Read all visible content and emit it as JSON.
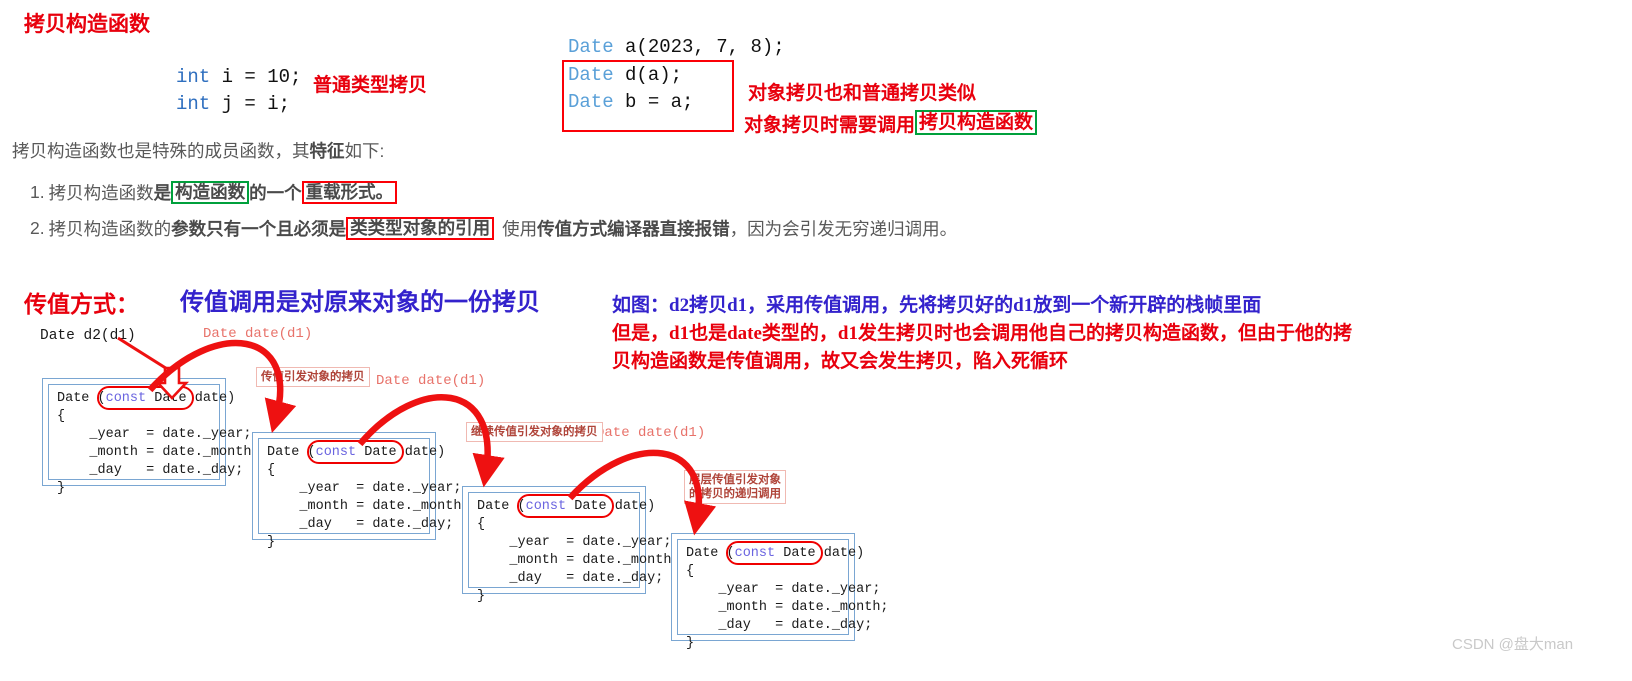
{
  "colors": {
    "red": "#e8000d",
    "blue": "#3322cc",
    "green": "#00a03c",
    "code_blue": "#2f6fbf",
    "frame_blue": "#7aa6d2",
    "prose_gray": "#595959",
    "watermark_gray": "#c9c9c9"
  },
  "header": {
    "title": "拷贝构造函数"
  },
  "builtin_copy": {
    "line1": "int i = 10;",
    "line2": "int j = i;",
    "note": "普通类型拷贝"
  },
  "object_copy": {
    "line1": "Date a(2023, 7, 8);",
    "line2": "Date d(a);",
    "line3": "Date b = a;",
    "note1": "对象拷贝也和普通拷贝类似",
    "note2_prefix": "对象拷贝时需要调用",
    "note2_highlight": "拷贝构造函数"
  },
  "body": {
    "intro_a": "拷贝构造函数也是特殊的成员函数，其",
    "intro_b": "特征",
    "intro_c": "如下:",
    "item1": {
      "number": "1.",
      "part_a": "拷贝构造函数",
      "part_b": "是",
      "green_box": "构造函数",
      "part_c": "的一个",
      "red_box": "重载形式。"
    },
    "item2": {
      "number": "2.",
      "part_a": "拷贝构造函数的",
      "part_b": "参数只有一个且必须是",
      "red_box": "类类型对象的引用",
      "part_c": "使用",
      "part_d": "传值方式编译器直接报错",
      "part_e": "，因为会引发无穷递归调用。"
    }
  },
  "pass_by_value": {
    "label": "传值方式：",
    "headline": "传值调用是对原来对象的一份拷贝",
    "explain_line1": "如图：d2拷贝d1，采用传值调用，先将拷贝好的d1放到一个新开辟的栈帧里面",
    "explain_line2": "但是，d1也是date类型的，d1发生拷贝时也会调用他自己的拷贝构造函数，但由于他的拷",
    "explain_line3": "贝构造函数是传值调用，故又会发生拷贝，陷入死循环"
  },
  "diagram": {
    "call_label": "Date d2(d1)",
    "copy_calls": [
      "Date date(d1)",
      "Date date(d1)",
      "Date date(d1)"
    ],
    "captions": [
      "传值引发对象的拷贝",
      "继续传值引发对象的拷贝",
      "层层传值引发对象\n的拷贝的递归调用"
    ],
    "frames": [
      {
        "sig_pre": "Date (",
        "sig_const": "const",
        "sig_rest": " Date date",
        "sig_post": ")",
        "open_brace": "{",
        "b1": "    _year  = date._year;",
        "b2": "    _month = date._month;",
        "b3": "    _day   = date._day;",
        "close_brace": "}"
      },
      {
        "sig_pre": "Date (",
        "sig_const": "const",
        "sig_rest": " Date date",
        "sig_post": ")",
        "open_brace": "{",
        "b1": "    _year  = date._year;",
        "b2": "    _month = date._month;",
        "b3": "    _day   = date._day;",
        "close_brace": "}"
      },
      {
        "sig_pre": "Date (",
        "sig_const": "const",
        "sig_rest": " Date date",
        "sig_post": ")",
        "open_brace": "{",
        "b1": "    _year  = date._year;",
        "b2": "    _month = date._month;",
        "b3": "    _day   = date._day;",
        "close_brace": "}"
      },
      {
        "sig_pre": "Date (",
        "sig_const": "const",
        "sig_rest": " Date date",
        "sig_post": ")",
        "open_brace": "{",
        "b1": "    _year  = date._year;",
        "b2": "    _month = date._month;",
        "b3": "    _day   = date._day;",
        "close_brace": "}"
      }
    ]
  },
  "watermark": {
    "text": "CSDN @盘大man"
  }
}
